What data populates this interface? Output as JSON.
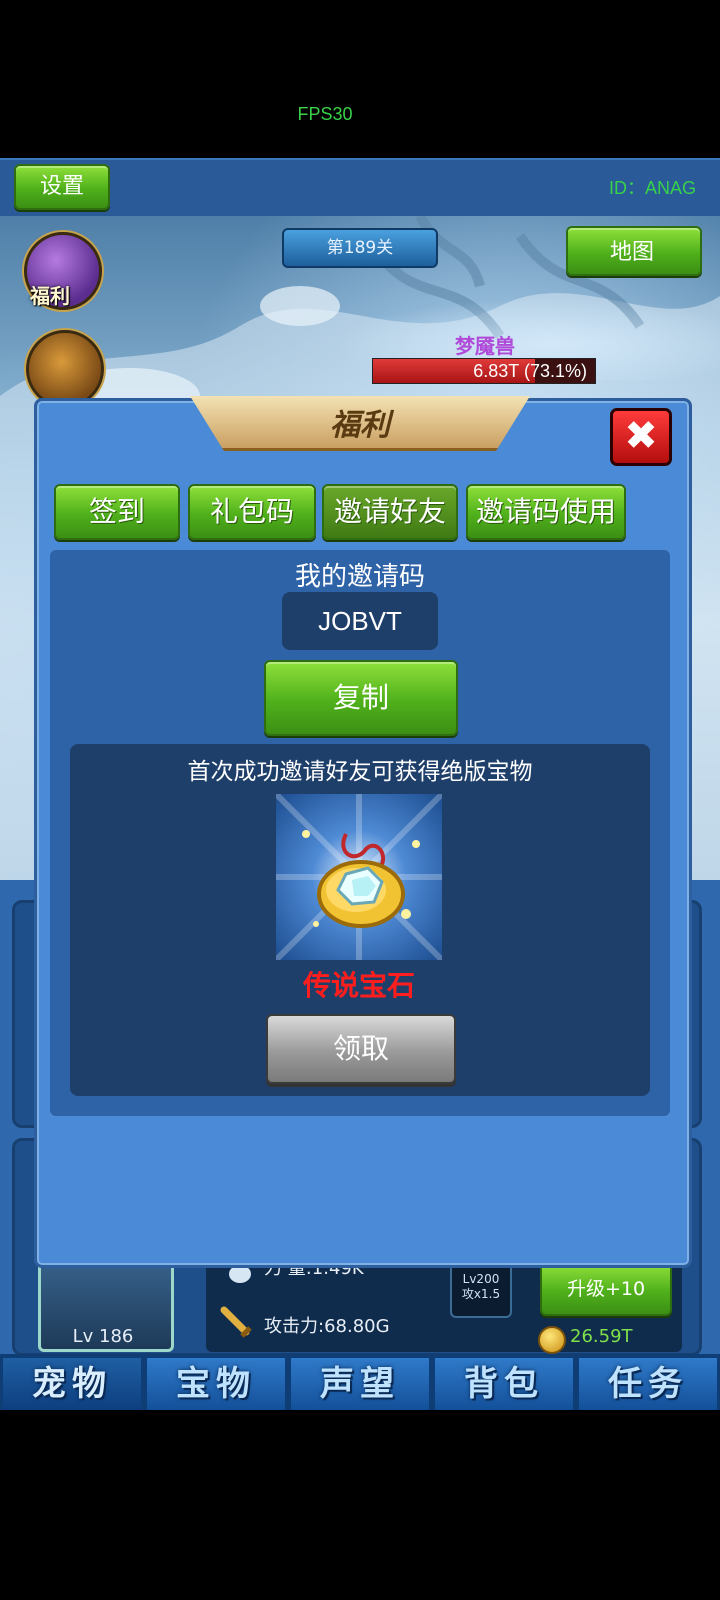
{
  "status": {
    "fps": "FPS30"
  },
  "topbar": {
    "settings_label": "设置",
    "player_id": "ID：ANAG"
  },
  "scene": {
    "stage": "第189关",
    "map_label": "地图",
    "side_icons": [
      {
        "label": "福利",
        "icon": "gift-icon"
      },
      {
        "label": "宝箱",
        "icon": "chest-icon"
      }
    ],
    "boss": {
      "name": "梦魇兽",
      "hp_text": "6.83T (73.1%)",
      "hp_fraction": 0.731
    }
  },
  "dialog": {
    "title": "福利",
    "close_glyph": "✖",
    "tabs": [
      {
        "label": "签到",
        "active": false
      },
      {
        "label": "礼包码",
        "active": false
      },
      {
        "label": "邀请好友",
        "active": true
      },
      {
        "label": "邀请码使用",
        "active": false
      }
    ],
    "my_code_title": "我的邀请码",
    "invite_code": "JOBVT",
    "copy_label": "复制",
    "reward_desc": "首次成功邀请好友可获得绝版宝物",
    "reward_item": {
      "name": "传说宝石",
      "icon": "legendary-gem-icon"
    },
    "claim_label": "领取"
  },
  "pet": {
    "level": "Lv 186",
    "strength": "力  量:1.49K",
    "attack": "攻击力:68.80G",
    "badge_line1": "Lv200",
    "badge_line2": "攻x1.5",
    "upgrade_label": "升级+10",
    "cost": "26.59T"
  },
  "bottom_nav": [
    "宠物",
    "宝物",
    "声望",
    "背包",
    "任务"
  ],
  "colors": {
    "accent_green": "#4fb01b",
    "panel_blue": "#4a8ad6",
    "reward_red": "#ff1e1e"
  }
}
